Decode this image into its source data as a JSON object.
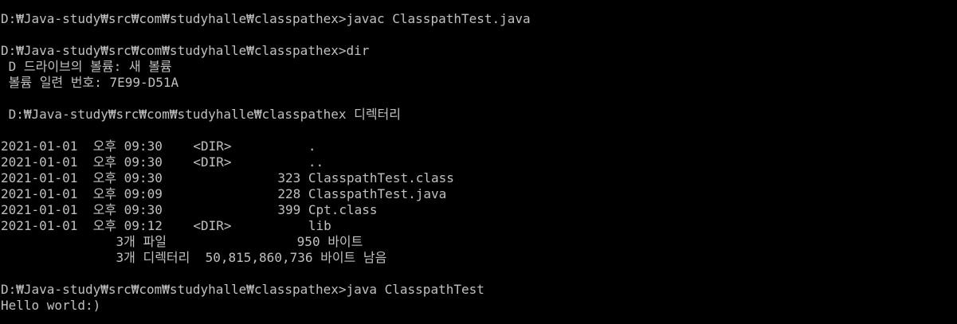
{
  "console": {
    "text_color": "#c0c0c0",
    "background_color": "#000000",
    "lines": [
      "D:₩Java-study₩src₩com₩studyhalle₩classpathex>javac ClasspathTest.java",
      "",
      "D:₩Java-study₩src₩com₩studyhalle₩classpathex>dir",
      " D 드라이브의 볼륨: 새 볼륨",
      " 볼륨 일련 번호: 7E99-D51A",
      "",
      " D:₩Java-study₩src₩com₩studyhalle₩classpathex 디렉터리",
      "",
      "2021-01-01  오후 09:30    <DIR>          .",
      "2021-01-01  오후 09:30    <DIR>          ..",
      "2021-01-01  오후 09:30               323 ClasspathTest.class",
      "2021-01-01  오후 09:09               228 ClasspathTest.java",
      "2021-01-01  오후 09:30               399 Cpt.class",
      "2021-01-01  오후 09:12    <DIR>          lib",
      "               3개 파일                 950 바이트",
      "               3개 디렉터리  50,815,860,736 바이트 남음",
      "",
      "D:₩Java-study₩src₩com₩studyhalle₩classpathex>java ClasspathTest",
      "Hello world:)"
    ]
  }
}
